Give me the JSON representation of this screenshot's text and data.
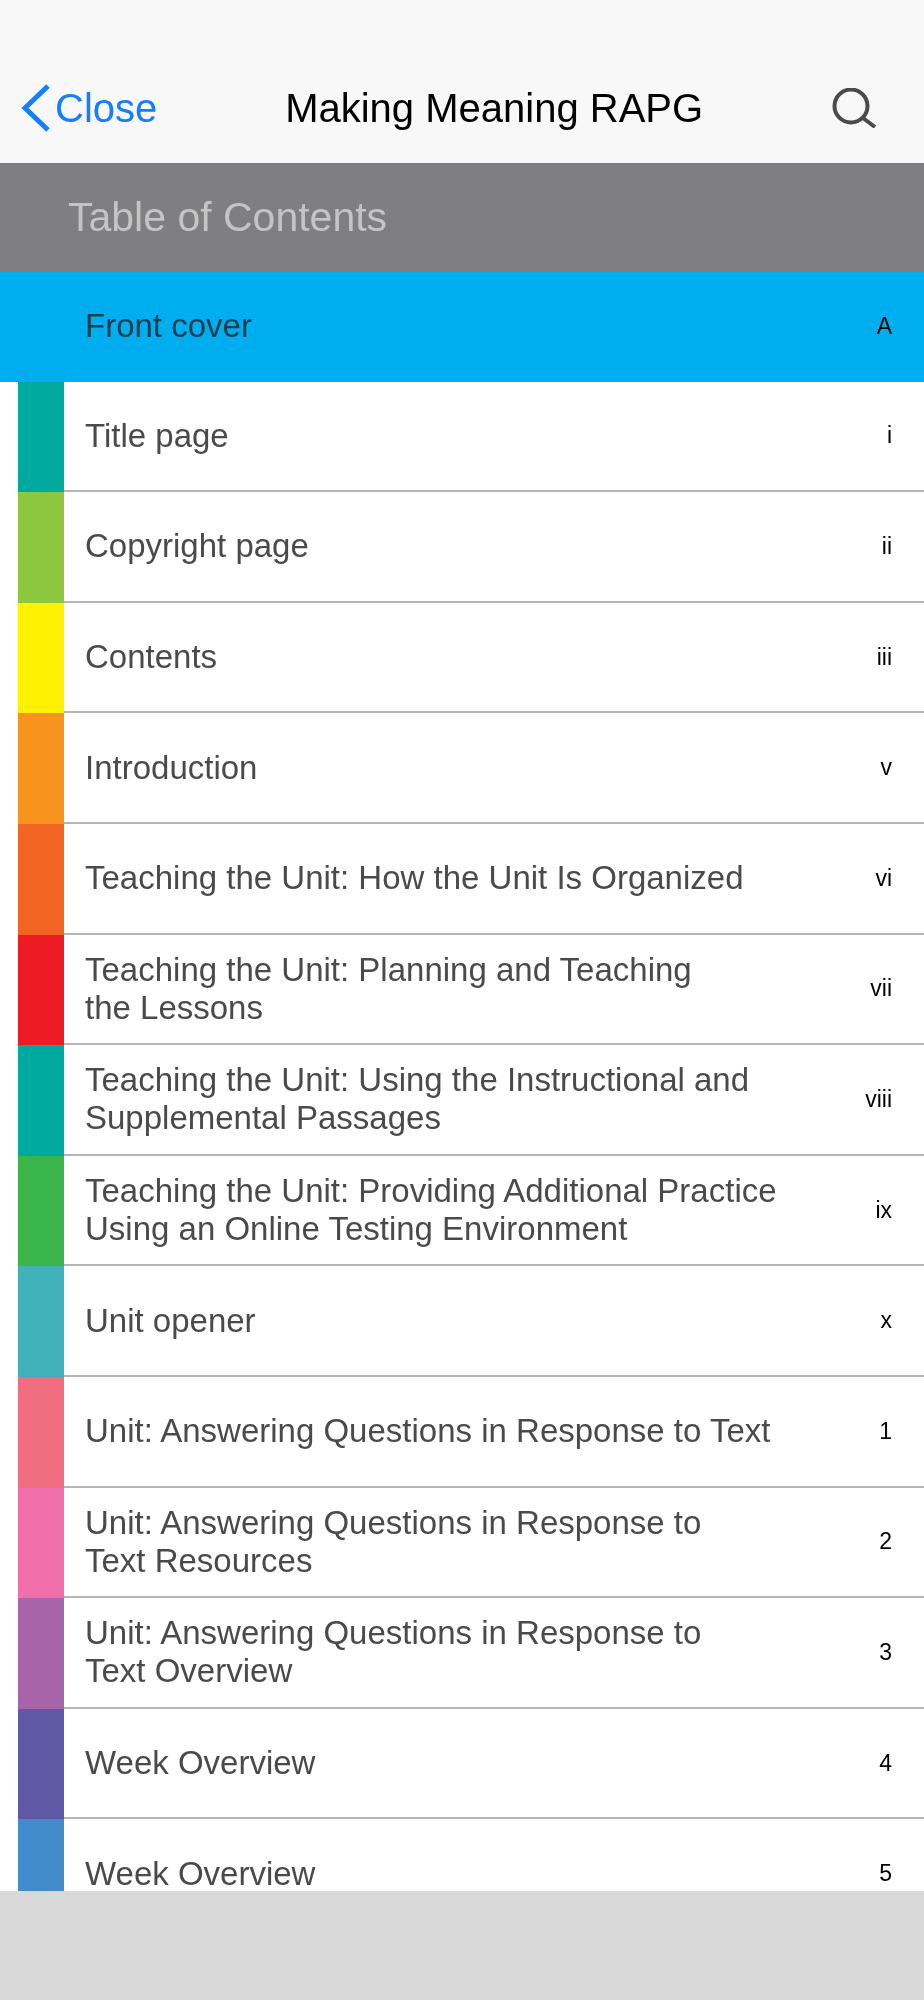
{
  "nav_bar": {
    "back_button": {
      "label": "Close"
    },
    "title": "Making Meaning RAPG"
  },
  "section_header": {
    "title": "Table of Contents"
  },
  "contents": [
    {
      "title": "Front cover",
      "page": "A",
      "selected": true
    },
    {
      "title": "Title page",
      "page": "i",
      "selected": false,
      "color": "#00a99d"
    },
    {
      "title": "Copyright page",
      "page": "ii",
      "selected": false,
      "color": "#8dc63f"
    },
    {
      "title": "Contents",
      "page": "iii",
      "selected": false,
      "color": "#fff200"
    },
    {
      "title": "Introduction",
      "page": "v",
      "selected": false,
      "color": "#f7941d"
    },
    {
      "title": "Teaching the Unit: How the Unit Is Organized",
      "page": "vi",
      "selected": false,
      "color": "#f26522"
    },
    {
      "title": "Teaching the Unit: Planning and Teaching\nthe Lessons",
      "page": "vii",
      "selected": false,
      "color": "#ed1c24"
    },
    {
      "title": "Teaching the Unit: Using the Instructional and\nSupplemental Passages",
      "page": "viii",
      "selected": false,
      "color": "#00a99d"
    },
    {
      "title": "Teaching the Unit: Providing Additional Practice\nUsing an Online Testing Environment",
      "page": "ix",
      "selected": false,
      "color": "#39b54a"
    },
    {
      "title": "Unit opener",
      "page": "x",
      "selected": false,
      "color": "#40b0b9"
    },
    {
      "title": "Unit: Answering Questions in Response to Text",
      "page": "1",
      "selected": false,
      "color": "#f06e7f"
    },
    {
      "title": "Unit: Answering Questions in Response to\nText Resources",
      "page": "2",
      "selected": false,
      "color": "#f06eaa"
    },
    {
      "title": "Unit: Answering Questions in Response to\nText Overview",
      "page": "3",
      "selected": false,
      "color": "#a864a8"
    },
    {
      "title": "Week Overview",
      "page": "4",
      "selected": false,
      "color": "#5f58a5"
    },
    {
      "title": "Week Overview",
      "page": "5",
      "selected": false,
      "color": "#438ccb"
    }
  ]
}
